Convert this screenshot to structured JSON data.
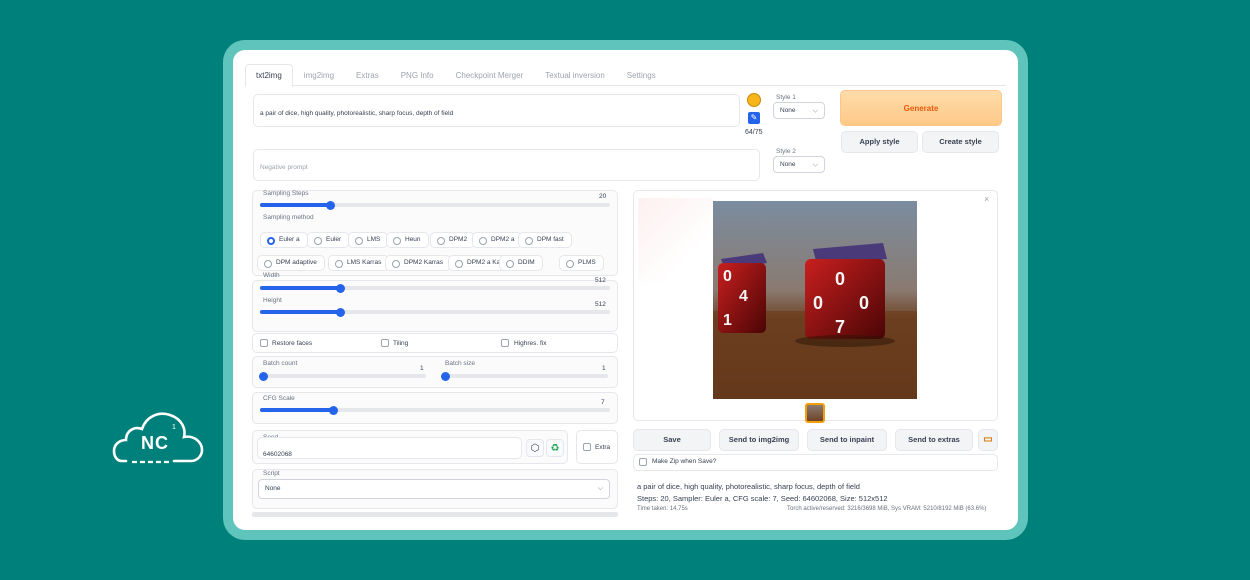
{
  "tabs": [
    "txt2img",
    "img2img",
    "Extras",
    "PNG Info",
    "Checkpoint Merger",
    "Textual inversion",
    "Settings"
  ],
  "prompt": {
    "value": "a pair of dice, high quality, photorealistic, sharp focus, depth of field",
    "token_count": "64/75"
  },
  "negative_prompt": {
    "placeholder": "Negative prompt"
  },
  "style1": {
    "label": "Style 1",
    "value": "None"
  },
  "style2": {
    "label": "Style 2",
    "value": "None"
  },
  "buttons": {
    "generate": "Generate",
    "apply_style": "Apply style",
    "create_style": "Create style"
  },
  "sampling_steps": {
    "label": "Sampling Steps",
    "value": "20",
    "fraction": 0.2
  },
  "sampling_method": {
    "label": "Sampling method",
    "options": [
      "Euler a",
      "Euler",
      "LMS",
      "Heun",
      "DPM2",
      "DPM2 a",
      "DPM fast",
      "DPM adaptive",
      "LMS Karras",
      "DPM2 Karras",
      "DPM2 a Karras",
      "DDIM",
      "PLMS"
    ],
    "selected": "Euler a"
  },
  "width": {
    "label": "Width",
    "value": "512",
    "fraction": 0.23
  },
  "height": {
    "label": "Height",
    "value": "512",
    "fraction": 0.23
  },
  "checkboxes": {
    "restore_faces": "Restore faces",
    "tiling": "Tiling",
    "highres": "Highres. fix"
  },
  "batch_count": {
    "label": "Batch count",
    "value": "1",
    "fraction": 0
  },
  "batch_size": {
    "label": "Batch size",
    "value": "1",
    "fraction": 0
  },
  "cfg_scale": {
    "label": "CFG Scale",
    "value": "7",
    "fraction": 0.21
  },
  "seed": {
    "label": "Seed",
    "value": "64602068",
    "extra": "Extra"
  },
  "script": {
    "label": "Script",
    "value": "None"
  },
  "output": {
    "close": "×",
    "save": "Save",
    "send_img2img": "Send to img2img",
    "send_inpaint": "Send to inpaint",
    "send_extras": "Send to extras",
    "make_zip": "Make Zip when Save?"
  },
  "info": {
    "prompt": "a pair of dice, high quality, photorealistic, sharp focus, depth of field",
    "params": "Steps: 20, Sampler: Euler a, CFG scale: 7, Seed: 64602068, Size: 512x512",
    "time": "Time taken: 14.75s",
    "vram": "Torch active/reserved: 3216/3698 MiB, Sys VRAM: 5210/8192 MiB (63.6%)"
  },
  "logo": {
    "text": "NC",
    "sup": "1"
  },
  "colors": {
    "background": "#00807a",
    "frame": "#5fc4bb",
    "accent": "#2563eb",
    "generate": "#ea580c"
  }
}
